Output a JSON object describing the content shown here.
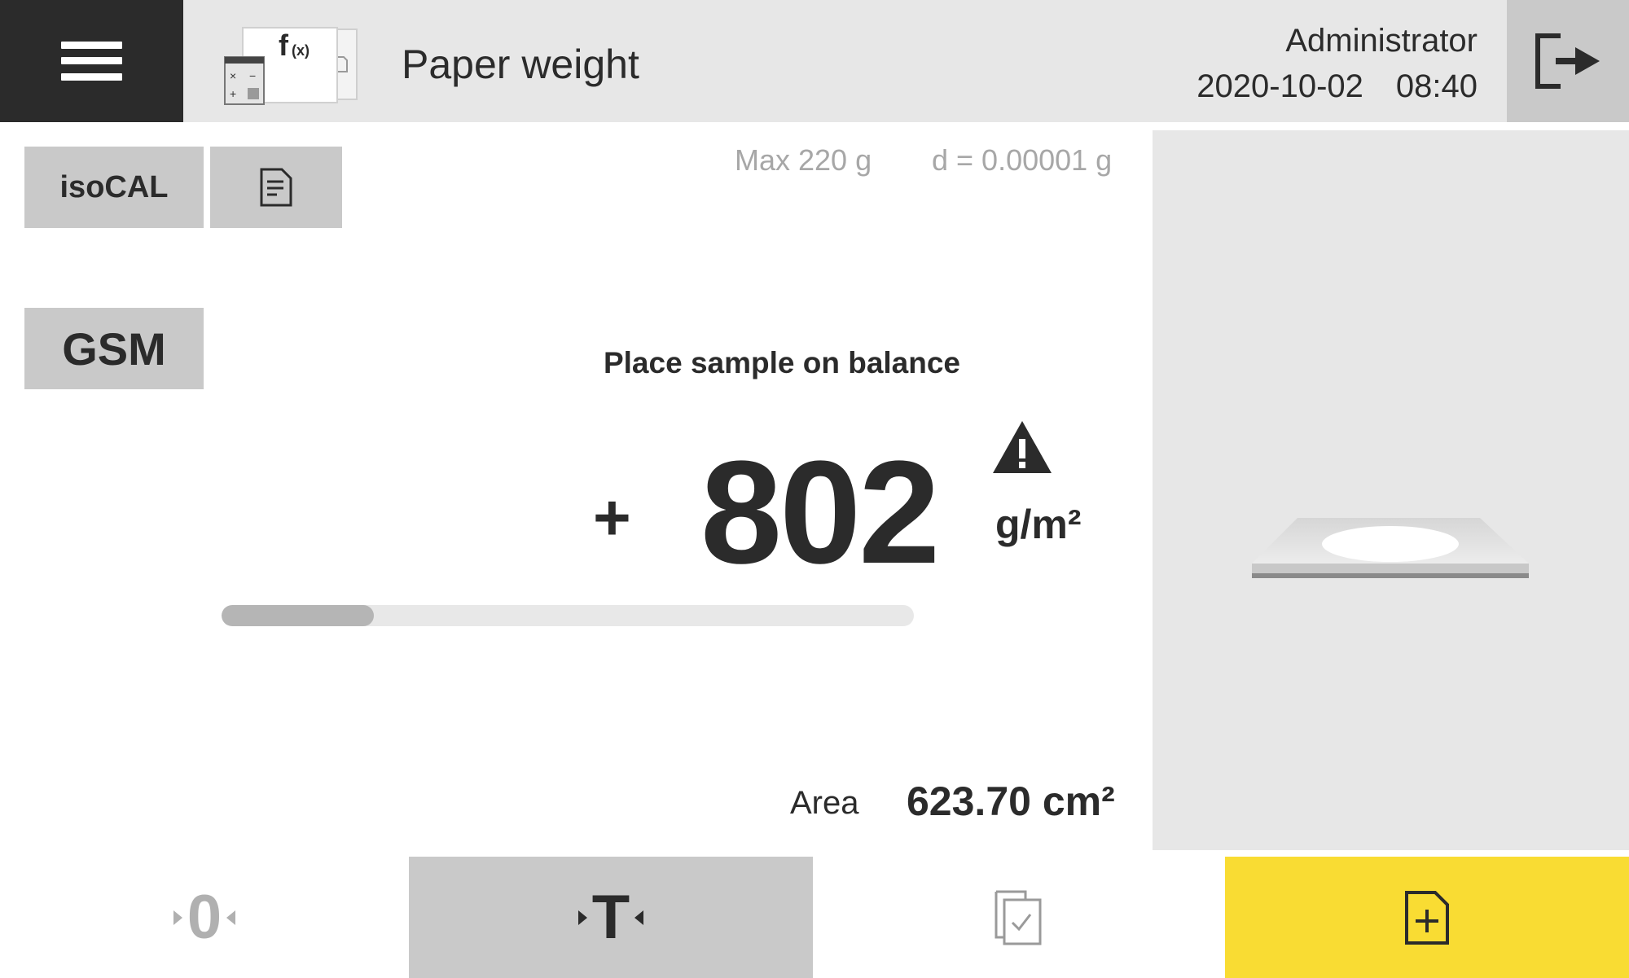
{
  "header": {
    "menu_icon": "hamburger-menu-icon",
    "app_icon": "function-calculator-icon",
    "title": "Paper weight",
    "user": "Administrator",
    "date": "2020-10-02",
    "time": "08:40",
    "logout_icon": "logout-icon"
  },
  "controls": {
    "isocal_label": "isoCAL",
    "document_icon": "document-icon",
    "gsm_label": "GSM"
  },
  "balance": {
    "max_capacity": "Max 220 g",
    "readability": "d = 0.00001 g",
    "prompt": "Place sample on balance",
    "sign": "+",
    "value": "802",
    "unit": "g/m²",
    "warning_icon": "warning-icon",
    "stability_progress": 0.22
  },
  "area": {
    "label": "Area",
    "value": "623.70 cm²"
  },
  "bottom_bar": {
    "zero_label": "0",
    "tare_label": "T",
    "results_icon": "results-check-icon",
    "add_icon": "add-document-icon"
  },
  "colors": {
    "dark": "#2b2b2b",
    "panel_grey": "#e7e7e7",
    "button_grey": "#c9c9c9",
    "accent_yellow": "#f9dc33",
    "muted_text": "#a7a7a7"
  }
}
